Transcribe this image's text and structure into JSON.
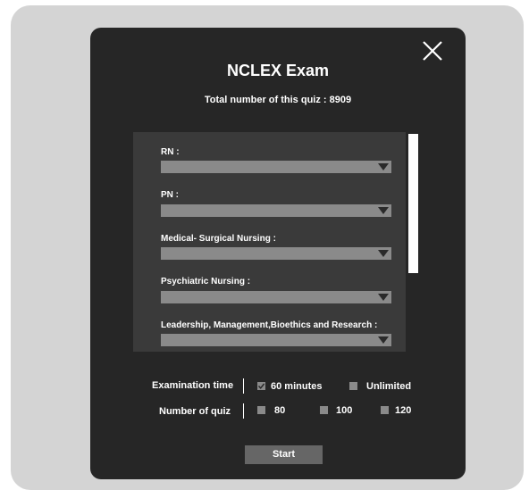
{
  "dialog": {
    "title": "NCLEX Exam",
    "subtitle": "Total number of this quiz : 8909",
    "close_icon": "close-icon"
  },
  "categories": [
    {
      "label": "RN :",
      "value": ""
    },
    {
      "label": "PN :",
      "value": ""
    },
    {
      "label": "Medical- Surgical Nursing :",
      "value": ""
    },
    {
      "label": "Psychiatric Nursing :",
      "value": ""
    },
    {
      "label": "Leadership, Management,Bioethics and Research :",
      "value": ""
    }
  ],
  "exam_time": {
    "label": "Examination time",
    "options": [
      {
        "label": "60 minutes",
        "checked": true
      },
      {
        "label": "Unlimited",
        "checked": false
      }
    ]
  },
  "quiz_count": {
    "label": "Number of quiz",
    "options": [
      {
        "label": "80",
        "checked": false
      },
      {
        "label": "100",
        "checked": false
      },
      {
        "label": "120",
        "checked": false
      }
    ]
  },
  "start_label": "Start",
  "colors": {
    "dialog_bg": "#262626",
    "panel_bg": "#3a3a3a",
    "select_bg": "#8a8a8a",
    "button_bg": "#666666",
    "outer_bg": "#d4d4d4"
  }
}
